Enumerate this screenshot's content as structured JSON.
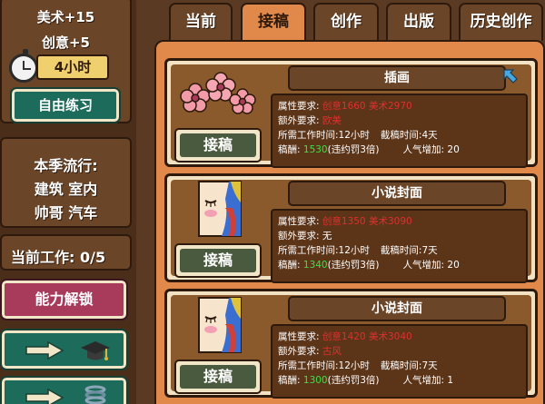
{
  "sidebar": {
    "stat_art": "美术+15",
    "stat_creativity": "创意+5",
    "time_left": "4小时",
    "practice_label": "自由练习",
    "trend_title": "本季流行:",
    "trend_line1": "建筑 室内",
    "trend_line2": "帅哥 汽车",
    "current_work": "当前工作: 0/5",
    "unlock_label": "能力解锁",
    "nav_buttons": [
      {
        "icon": "graduation-cap-icon"
      },
      {
        "icon": "spring-coil-icon"
      }
    ]
  },
  "tabs": [
    {
      "label": "当前",
      "active": false
    },
    {
      "label": "接稿",
      "active": true
    },
    {
      "label": "创作",
      "active": false
    },
    {
      "label": "出版",
      "active": false
    },
    {
      "label": "历史创作",
      "active": false
    }
  ],
  "labels": {
    "attr_req": "属性要求:",
    "extra_req": "额外要求:",
    "work_time": "所需工作时间:",
    "deadline": "截稿时间:",
    "reward": "稿酬:",
    "penalty": "(违约罚3倍)",
    "popularity": "人气增加:",
    "accept": "接稿"
  },
  "jobs": [
    {
      "title": "插画",
      "image": "flowers",
      "creativity_req": "创意1660",
      "art_req": "美术2970",
      "extra": "欧美",
      "extra_color": "red",
      "work_hours": "12小时",
      "deadline": "4天",
      "reward": "1530",
      "popularity": "20"
    },
    {
      "title": "小说封面",
      "image": "portrait",
      "creativity_req": "创意1350",
      "art_req": "美术3090",
      "extra": "无",
      "extra_color": "white",
      "work_hours": "12小时",
      "deadline": "7天",
      "reward": "1340",
      "popularity": "20"
    },
    {
      "title": "小说封面",
      "image": "portrait",
      "creativity_req": "创意1420",
      "art_req": "美术3040",
      "extra": "古风",
      "extra_color": "red",
      "work_hours": "12小时",
      "deadline": "7天",
      "reward": "1300",
      "popularity": "1"
    }
  ],
  "colors": {
    "panel_bg": "#6b4528",
    "tab_active": "#e0894a",
    "card_bg": "#8a5a2c",
    "button_teal": "#1d6b5a",
    "button_pink": "#a83a5c",
    "requirement_red": "#e02f2f",
    "reward_green": "#3be04a"
  }
}
